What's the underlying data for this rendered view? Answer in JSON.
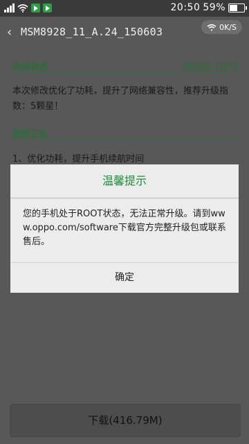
{
  "status_bar": {
    "time": "20:50",
    "battery_percent": "59%",
    "battery_level": 0.59
  },
  "header": {
    "back_icon": "chevron-left-icon",
    "title": "MSM8928_11_A.24_150603",
    "speed_label": "0K/S"
  },
  "recommend": {
    "heading": "本周推荐",
    "rating_label": "推荐度:100%",
    "text": "本次修改优化了功耗，提升了网络兼容性，推荐升级指数：5颗星！"
  },
  "changelog": {
    "heading": "更新日志",
    "item1": "1、优化功耗，提升手机续航时间"
  },
  "dialog": {
    "title": "温馨提示",
    "message": "您的手机处于ROOT状态，无法正常升级。请到www.oppo.com/software下载官方完整升级包或联系售后。",
    "ok_label": "确定"
  },
  "download_button": {
    "label": "下载(416.79M)"
  }
}
